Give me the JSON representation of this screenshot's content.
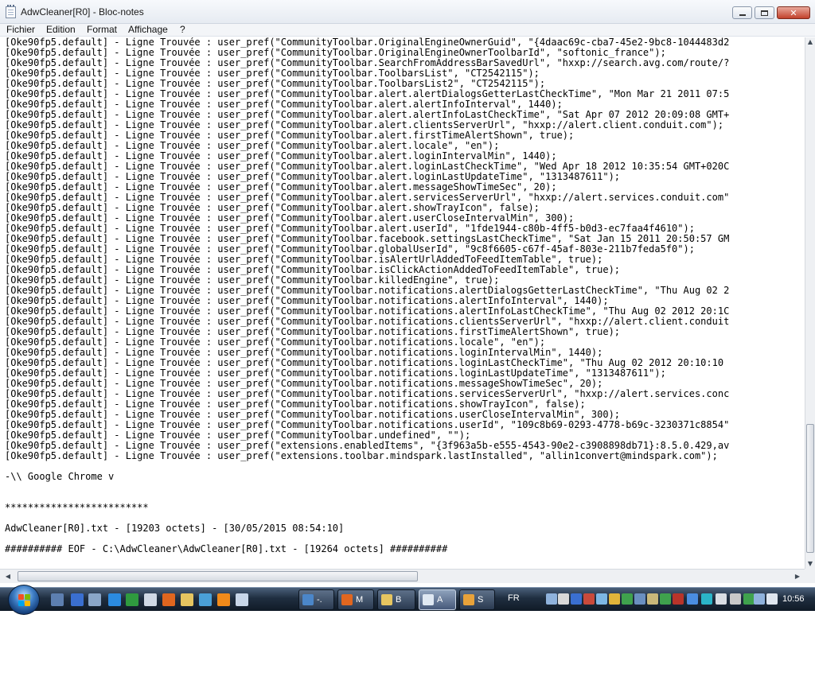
{
  "window": {
    "title": "AdwCleaner[R0] - Bloc-notes",
    "caption_buttons": {
      "minimize_icon": "minimize-icon",
      "maximize_icon": "maximize-icon",
      "close_icon": "close-icon"
    }
  },
  "menu": [
    "Fichier",
    "Edition",
    "Format",
    "Affichage",
    "?"
  ],
  "lines": [
    "[Oke90fp5.default] - Ligne Trouvée : user_pref(\"CommunityToolbar.OriginalEngineOwnerGuid\", \"{4daac69c-cba7-45e2-9bc8-1044483d2",
    "[Oke90fp5.default] - Ligne Trouvée : user_pref(\"CommunityToolbar.OriginalEngineOwnerToolbarId\", \"softonic_france\");",
    "[Oke90fp5.default] - Ligne Trouvée : user_pref(\"CommunityToolbar.SearchFromAddressBarSavedUrl\", \"hxxp://search.avg.com/route/?",
    "[Oke90fp5.default] - Ligne Trouvée : user_pref(\"CommunityToolbar.ToolbarsList\", \"CT2542115\");",
    "[Oke90fp5.default] - Ligne Trouvée : user_pref(\"CommunityToolbar.ToolbarsList2\", \"CT2542115\");",
    "[Oke90fp5.default] - Ligne Trouvée : user_pref(\"CommunityToolbar.alert.alertDialogsGetterLastCheckTime\", \"Mon Mar 21 2011 07:5",
    "[Oke90fp5.default] - Ligne Trouvée : user_pref(\"CommunityToolbar.alert.alertInfoInterval\", 1440);",
    "[Oke90fp5.default] - Ligne Trouvée : user_pref(\"CommunityToolbar.alert.alertInfoLastCheckTime\", \"Sat Apr 07 2012 20:09:08 GMT+",
    "[Oke90fp5.default] - Ligne Trouvée : user_pref(\"CommunityToolbar.alert.clientsServerUrl\", \"hxxp://alert.client.conduit.com\");",
    "[Oke90fp5.default] - Ligne Trouvée : user_pref(\"CommunityToolbar.alert.firstTimeAlertShown\", true);",
    "[Oke90fp5.default] - Ligne Trouvée : user_pref(\"CommunityToolbar.alert.locale\", \"en\");",
    "[Oke90fp5.default] - Ligne Trouvée : user_pref(\"CommunityToolbar.alert.loginIntervalMin\", 1440);",
    "[Oke90fp5.default] - Ligne Trouvée : user_pref(\"CommunityToolbar.alert.loginLastCheckTime\", \"Wed Apr 18 2012 10:35:54 GMT+020C",
    "[Oke90fp5.default] - Ligne Trouvée : user_pref(\"CommunityToolbar.alert.loginLastUpdateTime\", \"1313487611\");",
    "[Oke90fp5.default] - Ligne Trouvée : user_pref(\"CommunityToolbar.alert.messageShowTimeSec\", 20);",
    "[Oke90fp5.default] - Ligne Trouvée : user_pref(\"CommunityToolbar.alert.servicesServerUrl\", \"hxxp://alert.services.conduit.com\"",
    "[Oke90fp5.default] - Ligne Trouvée : user_pref(\"CommunityToolbar.alert.showTrayIcon\", false);",
    "[Oke90fp5.default] - Ligne Trouvée : user_pref(\"CommunityToolbar.alert.userCloseIntervalMin\", 300);",
    "[Oke90fp5.default] - Ligne Trouvée : user_pref(\"CommunityToolbar.alert.userId\", \"1fde1944-c80b-4ff5-b0d3-ec7faa4f4610\");",
    "[Oke90fp5.default] - Ligne Trouvée : user_pref(\"CommunityToolbar.facebook.settingsLastCheckTime\", \"Sat Jan 15 2011 20:50:57 GM",
    "[Oke90fp5.default] - Ligne Trouvée : user_pref(\"CommunityToolbar.globalUserId\", \"9c8f6605-c67f-45af-803e-211b7feda5f0\");",
    "[Oke90fp5.default] - Ligne Trouvée : user_pref(\"CommunityToolbar.isAlertUrlAddedToFeedItemTable\", true);",
    "[Oke90fp5.default] - Ligne Trouvée : user_pref(\"CommunityToolbar.isClickActionAddedToFeedItemTable\", true);",
    "[Oke90fp5.default] - Ligne Trouvée : user_pref(\"CommunityToolbar.killedEngine\", true);",
    "[Oke90fp5.default] - Ligne Trouvée : user_pref(\"CommunityToolbar.notifications.alertDialogsGetterLastCheckTime\", \"Thu Aug 02 2",
    "[Oke90fp5.default] - Ligne Trouvée : user_pref(\"CommunityToolbar.notifications.alertInfoInterval\", 1440);",
    "[Oke90fp5.default] - Ligne Trouvée : user_pref(\"CommunityToolbar.notifications.alertInfoLastCheckTime\", \"Thu Aug 02 2012 20:1C",
    "[Oke90fp5.default] - Ligne Trouvée : user_pref(\"CommunityToolbar.notifications.clientsServerUrl\", \"hxxp://alert.client.conduit",
    "[Oke90fp5.default] - Ligne Trouvée : user_pref(\"CommunityToolbar.notifications.firstTimeAlertShown\", true);",
    "[Oke90fp5.default] - Ligne Trouvée : user_pref(\"CommunityToolbar.notifications.locale\", \"en\");",
    "[Oke90fp5.default] - Ligne Trouvée : user_pref(\"CommunityToolbar.notifications.loginIntervalMin\", 1440);",
    "[Oke90fp5.default] - Ligne Trouvée : user_pref(\"CommunityToolbar.notifications.loginLastCheckTime\", \"Thu Aug 02 2012 20:10:10",
    "[Oke90fp5.default] - Ligne Trouvée : user_pref(\"CommunityToolbar.notifications.loginLastUpdateTime\", \"1313487611\");",
    "[Oke90fp5.default] - Ligne Trouvée : user_pref(\"CommunityToolbar.notifications.messageShowTimeSec\", 20);",
    "[Oke90fp5.default] - Ligne Trouvée : user_pref(\"CommunityToolbar.notifications.servicesServerUrl\", \"hxxp://alert.services.conc",
    "[Oke90fp5.default] - Ligne Trouvée : user_pref(\"CommunityToolbar.notifications.showTrayIcon\", false);",
    "[Oke90fp5.default] - Ligne Trouvée : user_pref(\"CommunityToolbar.notifications.userCloseIntervalMin\", 300);",
    "[Oke90fp5.default] - Ligne Trouvée : user_pref(\"CommunityToolbar.notifications.userId\", \"109c8b69-0293-4778-b69c-3230371c8854\"",
    "[Oke90fp5.default] - Ligne Trouvée : user_pref(\"CommunityToolbar.undefined\", \"\");",
    "[Oke90fp5.default] - Ligne Trouvée : user_pref(\"extensions.enabledItems\", \"{3f963a5b-e555-4543-90e2-c3908898db71}:8.5.0.429,av",
    "[Oke90fp5.default] - Ligne Trouvée : user_pref(\"extensions.toolbar.mindspark.lastInstalled\", \"allin1convert@mindspark.com\");",
    "",
    "-\\\\ Google Chrome v",
    "",
    "",
    "*************************",
    "",
    "AdwCleaner[R0].txt - [19203 octets] - [30/05/2015 08:54:10]",
    "",
    "########## EOF - C:\\AdwCleaner\\AdwCleaner[R0].txt - [19264 octets] ##########"
  ],
  "taskbar": {
    "start_icon": "windows-start-icon",
    "quicklaunch": [
      {
        "icon": "show-desktop-icon",
        "color": "#5d7fb0"
      },
      {
        "icon": "bluetooth-icon",
        "color": "#3a6fd0"
      },
      {
        "icon": "network-icon",
        "color": "#8aa6c8"
      },
      {
        "icon": "internet-explorer-icon",
        "color": "#2b8be0"
      },
      {
        "icon": "spreadsheet-icon",
        "color": "#2f9a3f"
      },
      {
        "icon": "document-icon",
        "color": "#cfd8e4"
      },
      {
        "icon": "firefox-icon",
        "color": "#e0661f"
      },
      {
        "icon": "explorer-icon",
        "color": "#e6c560"
      },
      {
        "icon": "globe-icon",
        "color": "#4aa0d8"
      },
      {
        "icon": "vlc-icon",
        "color": "#f08a1a"
      },
      {
        "icon": "window-icon",
        "color": "#c8d6e8"
      }
    ],
    "tasks": [
      {
        "label": "-.",
        "icon": "settings-app-icon",
        "color": "#4b86c9",
        "active": false
      },
      {
        "label": "M",
        "icon": "firefox-task-icon",
        "color": "#e0661f",
        "active": false
      },
      {
        "label": "B",
        "icon": "folder-task-icon",
        "color": "#e6c560",
        "active": false
      },
      {
        "label": "A",
        "icon": "notepad-task-icon",
        "color": "#dfe8f2",
        "active": true
      },
      {
        "label": "S",
        "icon": "paint-task-icon",
        "color": "#e8a23a",
        "active": false
      }
    ],
    "language": "FR",
    "tray": [
      {
        "icon": "tray-network-icon",
        "color": "#8fb2dc"
      },
      {
        "icon": "tray-recycle-icon",
        "color": "#d8d8d8"
      },
      {
        "icon": "tray-bluetooth-icon",
        "color": "#3a6fd0"
      },
      {
        "icon": "tray-antivirus-icon",
        "color": "#c94a3b"
      },
      {
        "icon": "tray-monitor-icon",
        "color": "#7db7e4"
      },
      {
        "icon": "tray-chrome-icon",
        "color": "#e0b43a"
      },
      {
        "icon": "tray-update-icon",
        "color": "#3fa24d"
      },
      {
        "icon": "tray-display-icon",
        "color": "#6a8fc0"
      },
      {
        "icon": "tray-speaker-small-icon",
        "color": "#c9b87a"
      },
      {
        "icon": "tray-power-icon",
        "color": "#3fa24d"
      },
      {
        "icon": "tray-shield-icon",
        "color": "#b8342a"
      },
      {
        "icon": "tray-app-icon",
        "color": "#4a8de0"
      },
      {
        "icon": "tray-i-icon",
        "color": "#2bb5c8"
      },
      {
        "icon": "tray-a-icon",
        "color": "#d9dde3"
      },
      {
        "icon": "tray-usb-icon",
        "color": "#c8c8c8"
      },
      {
        "icon": "tray-check-icon",
        "color": "#3fa24d"
      },
      {
        "icon": "tray-network2-icon",
        "color": "#8fb2dc"
      },
      {
        "icon": "tray-volume-icon",
        "color": "#dfe6ef"
      }
    ],
    "clock": "10:56"
  },
  "colors": {
    "taskbar": "#1f2e40",
    "text": "#000000",
    "titlebar": "#e6ebf2"
  }
}
